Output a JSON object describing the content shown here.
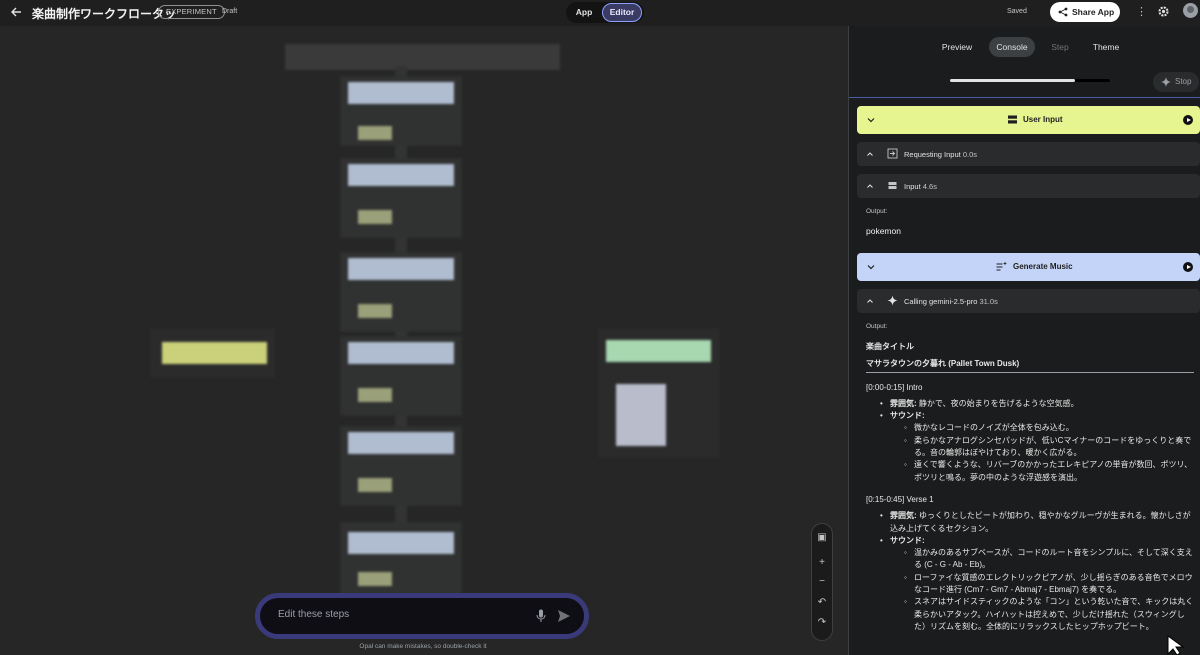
{
  "header": {
    "title": "楽曲制作ワークフロータッ",
    "badge": "EXPERIMENT",
    "status": "Draft",
    "mode_app": "App",
    "mode_editor": "Editor",
    "saved": "Saved",
    "share": "Share App",
    "menu": "⋮"
  },
  "canvas": {
    "prompt_placeholder": "Edit these steps",
    "disclaimer": "Opal can make mistakes, so double-check it"
  },
  "panel": {
    "tabs": [
      "Preview",
      "Console",
      "Step",
      "Theme"
    ],
    "progress": 0.78,
    "stop": "Stop",
    "steps": {
      "user_input": "User Input",
      "requesting_input": "Requesting Input",
      "requesting_input_dur": "0.0s",
      "input": "Input",
      "input_dur": "4.6s",
      "output_label_1": "Output:",
      "output_value_1": "pokemon",
      "generate_music": "Generate Music",
      "calling": "Calling gemini-2.5-pro",
      "calling_dur": "31.0s",
      "output_label_2": "Output:"
    },
    "content": {
      "title": "楽曲タイトル",
      "subtitle": "マサラタウンの夕暮れ (Pallet Town Dusk)",
      "intro_heading": "[0:00-0:15] Intro",
      "intro_mood_label": "雰囲気:",
      "intro_mood": " 静かで、夜の始まりを告げるような空気感。",
      "intro_sound_label": "サウンド:",
      "intro_sounds": [
        "微かなレコードのノイズが全体を包み込む。",
        "柔らかなアナログシンセパッドが、低いCマイナーのコードをゆっくりと奏でる。音の輪郭はぼやけており、暖かく広がる。",
        "遠くで響くような、リバーブのかかったエレキピアノの単音が数回、ポツリ、ポツリと鳴る。夢の中のような浮遊感を演出。"
      ],
      "verse_heading": "[0:15-0:45] Verse 1",
      "verse_mood_label": "雰囲気:",
      "verse_mood": " ゆっくりとしたビートが加わり、穏やかなグルーヴが生まれる。懐かしさが込み上げてくるセクション。",
      "verse_sound_label": "サウンド:",
      "verse_sounds": [
        "温かみのあるサブベースが、コードのルート音をシンプルに、そして深く支える (C - G - Ab - Eb)。",
        "ローファイな質感のエレクトリックピアノが、少し揺らぎのある音色でメロウなコード進行 (Cm7 - Gm7 - Abmaj7 - Ebmaj7) を奏でる。",
        "スネアはサイドスティックのような「コン」という乾いた音で、キックは丸く柔らかいアタック。ハイハットは控えめで、少しだけ揺れた（スウィングした）リズムを刻む。全体的にリラックスしたヒップホップビート。"
      ]
    }
  },
  "colors": {
    "user_input_bg": "#e6f58f",
    "generate_music_bg": "#c3d4f8",
    "accent": "#8fa0ff"
  }
}
